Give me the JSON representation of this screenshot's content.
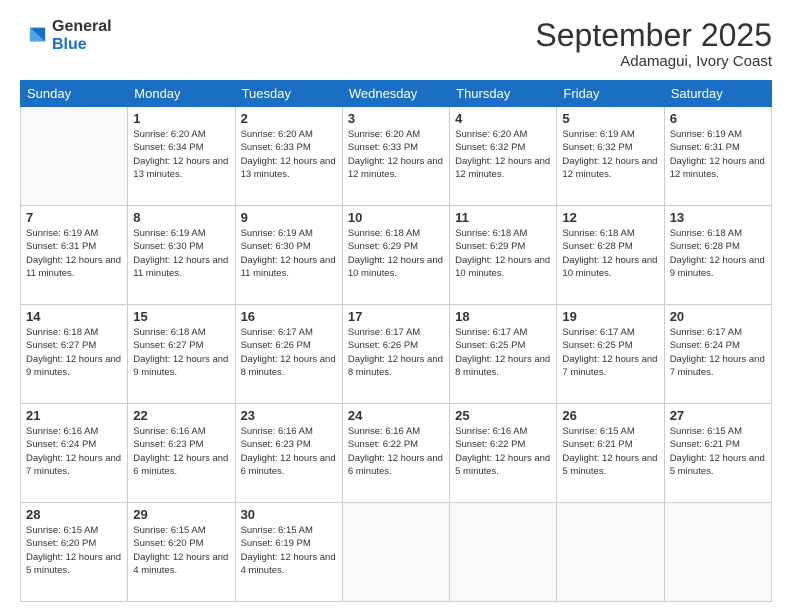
{
  "logo": {
    "general": "General",
    "blue": "Blue"
  },
  "header": {
    "month": "September 2025",
    "location": "Adamagui, Ivory Coast"
  },
  "days": [
    "Sunday",
    "Monday",
    "Tuesday",
    "Wednesday",
    "Thursday",
    "Friday",
    "Saturday"
  ],
  "weeks": [
    [
      {
        "day": "",
        "info": ""
      },
      {
        "day": "1",
        "info": "Sunrise: 6:20 AM\nSunset: 6:34 PM\nDaylight: 12 hours\nand 13 minutes."
      },
      {
        "day": "2",
        "info": "Sunrise: 6:20 AM\nSunset: 6:33 PM\nDaylight: 12 hours\nand 13 minutes."
      },
      {
        "day": "3",
        "info": "Sunrise: 6:20 AM\nSunset: 6:33 PM\nDaylight: 12 hours\nand 12 minutes."
      },
      {
        "day": "4",
        "info": "Sunrise: 6:20 AM\nSunset: 6:32 PM\nDaylight: 12 hours\nand 12 minutes."
      },
      {
        "day": "5",
        "info": "Sunrise: 6:19 AM\nSunset: 6:32 PM\nDaylight: 12 hours\nand 12 minutes."
      },
      {
        "day": "6",
        "info": "Sunrise: 6:19 AM\nSunset: 6:31 PM\nDaylight: 12 hours\nand 12 minutes."
      }
    ],
    [
      {
        "day": "7",
        "info": "Sunrise: 6:19 AM\nSunset: 6:31 PM\nDaylight: 12 hours\nand 11 minutes."
      },
      {
        "day": "8",
        "info": "Sunrise: 6:19 AM\nSunset: 6:30 PM\nDaylight: 12 hours\nand 11 minutes."
      },
      {
        "day": "9",
        "info": "Sunrise: 6:19 AM\nSunset: 6:30 PM\nDaylight: 12 hours\nand 11 minutes."
      },
      {
        "day": "10",
        "info": "Sunrise: 6:18 AM\nSunset: 6:29 PM\nDaylight: 12 hours\nand 10 minutes."
      },
      {
        "day": "11",
        "info": "Sunrise: 6:18 AM\nSunset: 6:29 PM\nDaylight: 12 hours\nand 10 minutes."
      },
      {
        "day": "12",
        "info": "Sunrise: 6:18 AM\nSunset: 6:28 PM\nDaylight: 12 hours\nand 10 minutes."
      },
      {
        "day": "13",
        "info": "Sunrise: 6:18 AM\nSunset: 6:28 PM\nDaylight: 12 hours\nand 9 minutes."
      }
    ],
    [
      {
        "day": "14",
        "info": "Sunrise: 6:18 AM\nSunset: 6:27 PM\nDaylight: 12 hours\nand 9 minutes."
      },
      {
        "day": "15",
        "info": "Sunrise: 6:18 AM\nSunset: 6:27 PM\nDaylight: 12 hours\nand 9 minutes."
      },
      {
        "day": "16",
        "info": "Sunrise: 6:17 AM\nSunset: 6:26 PM\nDaylight: 12 hours\nand 8 minutes."
      },
      {
        "day": "17",
        "info": "Sunrise: 6:17 AM\nSunset: 6:26 PM\nDaylight: 12 hours\nand 8 minutes."
      },
      {
        "day": "18",
        "info": "Sunrise: 6:17 AM\nSunset: 6:25 PM\nDaylight: 12 hours\nand 8 minutes."
      },
      {
        "day": "19",
        "info": "Sunrise: 6:17 AM\nSunset: 6:25 PM\nDaylight: 12 hours\nand 7 minutes."
      },
      {
        "day": "20",
        "info": "Sunrise: 6:17 AM\nSunset: 6:24 PM\nDaylight: 12 hours\nand 7 minutes."
      }
    ],
    [
      {
        "day": "21",
        "info": "Sunrise: 6:16 AM\nSunset: 6:24 PM\nDaylight: 12 hours\nand 7 minutes."
      },
      {
        "day": "22",
        "info": "Sunrise: 6:16 AM\nSunset: 6:23 PM\nDaylight: 12 hours\nand 6 minutes."
      },
      {
        "day": "23",
        "info": "Sunrise: 6:16 AM\nSunset: 6:23 PM\nDaylight: 12 hours\nand 6 minutes."
      },
      {
        "day": "24",
        "info": "Sunrise: 6:16 AM\nSunset: 6:22 PM\nDaylight: 12 hours\nand 6 minutes."
      },
      {
        "day": "25",
        "info": "Sunrise: 6:16 AM\nSunset: 6:22 PM\nDaylight: 12 hours\nand 5 minutes."
      },
      {
        "day": "26",
        "info": "Sunrise: 6:15 AM\nSunset: 6:21 PM\nDaylight: 12 hours\nand 5 minutes."
      },
      {
        "day": "27",
        "info": "Sunrise: 6:15 AM\nSunset: 6:21 PM\nDaylight: 12 hours\nand 5 minutes."
      }
    ],
    [
      {
        "day": "28",
        "info": "Sunrise: 6:15 AM\nSunset: 6:20 PM\nDaylight: 12 hours\nand 5 minutes."
      },
      {
        "day": "29",
        "info": "Sunrise: 6:15 AM\nSunset: 6:20 PM\nDaylight: 12 hours\nand 4 minutes."
      },
      {
        "day": "30",
        "info": "Sunrise: 6:15 AM\nSunset: 6:19 PM\nDaylight: 12 hours\nand 4 minutes."
      },
      {
        "day": "",
        "info": ""
      },
      {
        "day": "",
        "info": ""
      },
      {
        "day": "",
        "info": ""
      },
      {
        "day": "",
        "info": ""
      }
    ]
  ]
}
